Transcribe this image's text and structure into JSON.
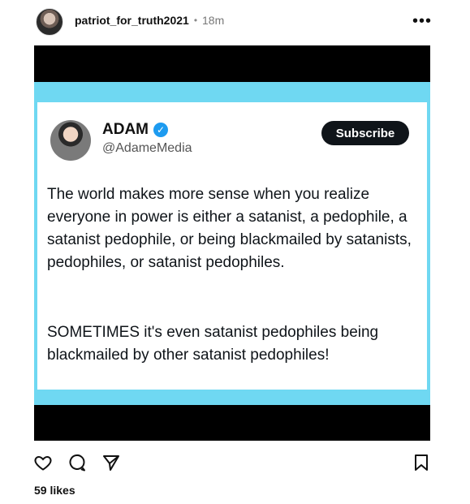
{
  "post": {
    "username": "patriot_for_truth2021",
    "separator": "•",
    "time": "18m",
    "likes": "59 likes"
  },
  "tweet": {
    "name": "ADAM",
    "handle": "@AdameMedia",
    "subscribe_label": "Subscribe",
    "paragraph_1": "The world makes more sense when you realize everyone in power is either a satanist, a pedophile, a satanist pedophile, or being blackmailed by satanists, pedophiles, or satanist pedophiles.",
    "paragraph_2": "SOMETIMES it's even satanist pedophiles being blackmailed by other satanist pedophiles!"
  },
  "icons": {
    "more": "more-options-icon",
    "like": "heart-icon",
    "comment": "comment-icon",
    "share": "send-icon",
    "save": "bookmark-icon",
    "verified": "verified-badge-icon"
  },
  "colors": {
    "band": "#6fd8f2",
    "verified": "#1d9bf0",
    "subscribe_bg": "#0f1419"
  }
}
